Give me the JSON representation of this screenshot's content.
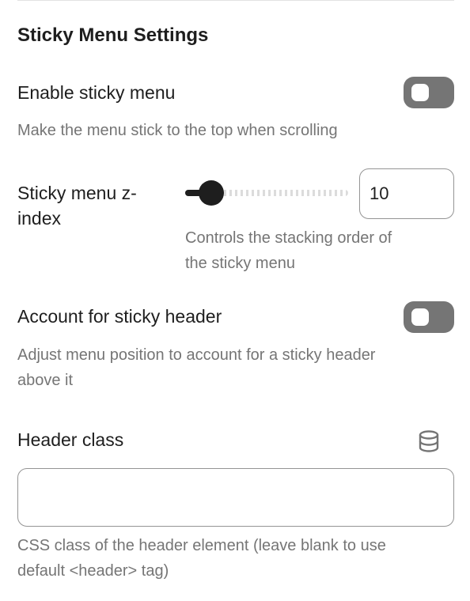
{
  "section": {
    "title": "Sticky Menu Settings"
  },
  "enable_sticky": {
    "label": "Enable sticky menu",
    "help": "Make the menu stick to the top when scrolling",
    "enabled": false
  },
  "z_index": {
    "label_line1": "Sticky menu z-",
    "label_line2": "index",
    "value": "10",
    "slider_fraction": 0.16,
    "help_line1": "Controls the stacking order of",
    "help_line2": "the sticky menu"
  },
  "account_header": {
    "label": "Account for sticky header",
    "help_line1": "Adjust menu position to account for a sticky header",
    "help_line2": "above it",
    "enabled": false
  },
  "header_class": {
    "label": "Header class",
    "icon": "database-icon",
    "value": "",
    "placeholder": "",
    "help_line1": "CSS class of the header element (leave blank to use",
    "help_line2": "default <header> tag)"
  },
  "colors": {
    "text": "#1e1e1e",
    "muted": "#757575",
    "toggle_off": "#757575",
    "border": "#949494"
  }
}
